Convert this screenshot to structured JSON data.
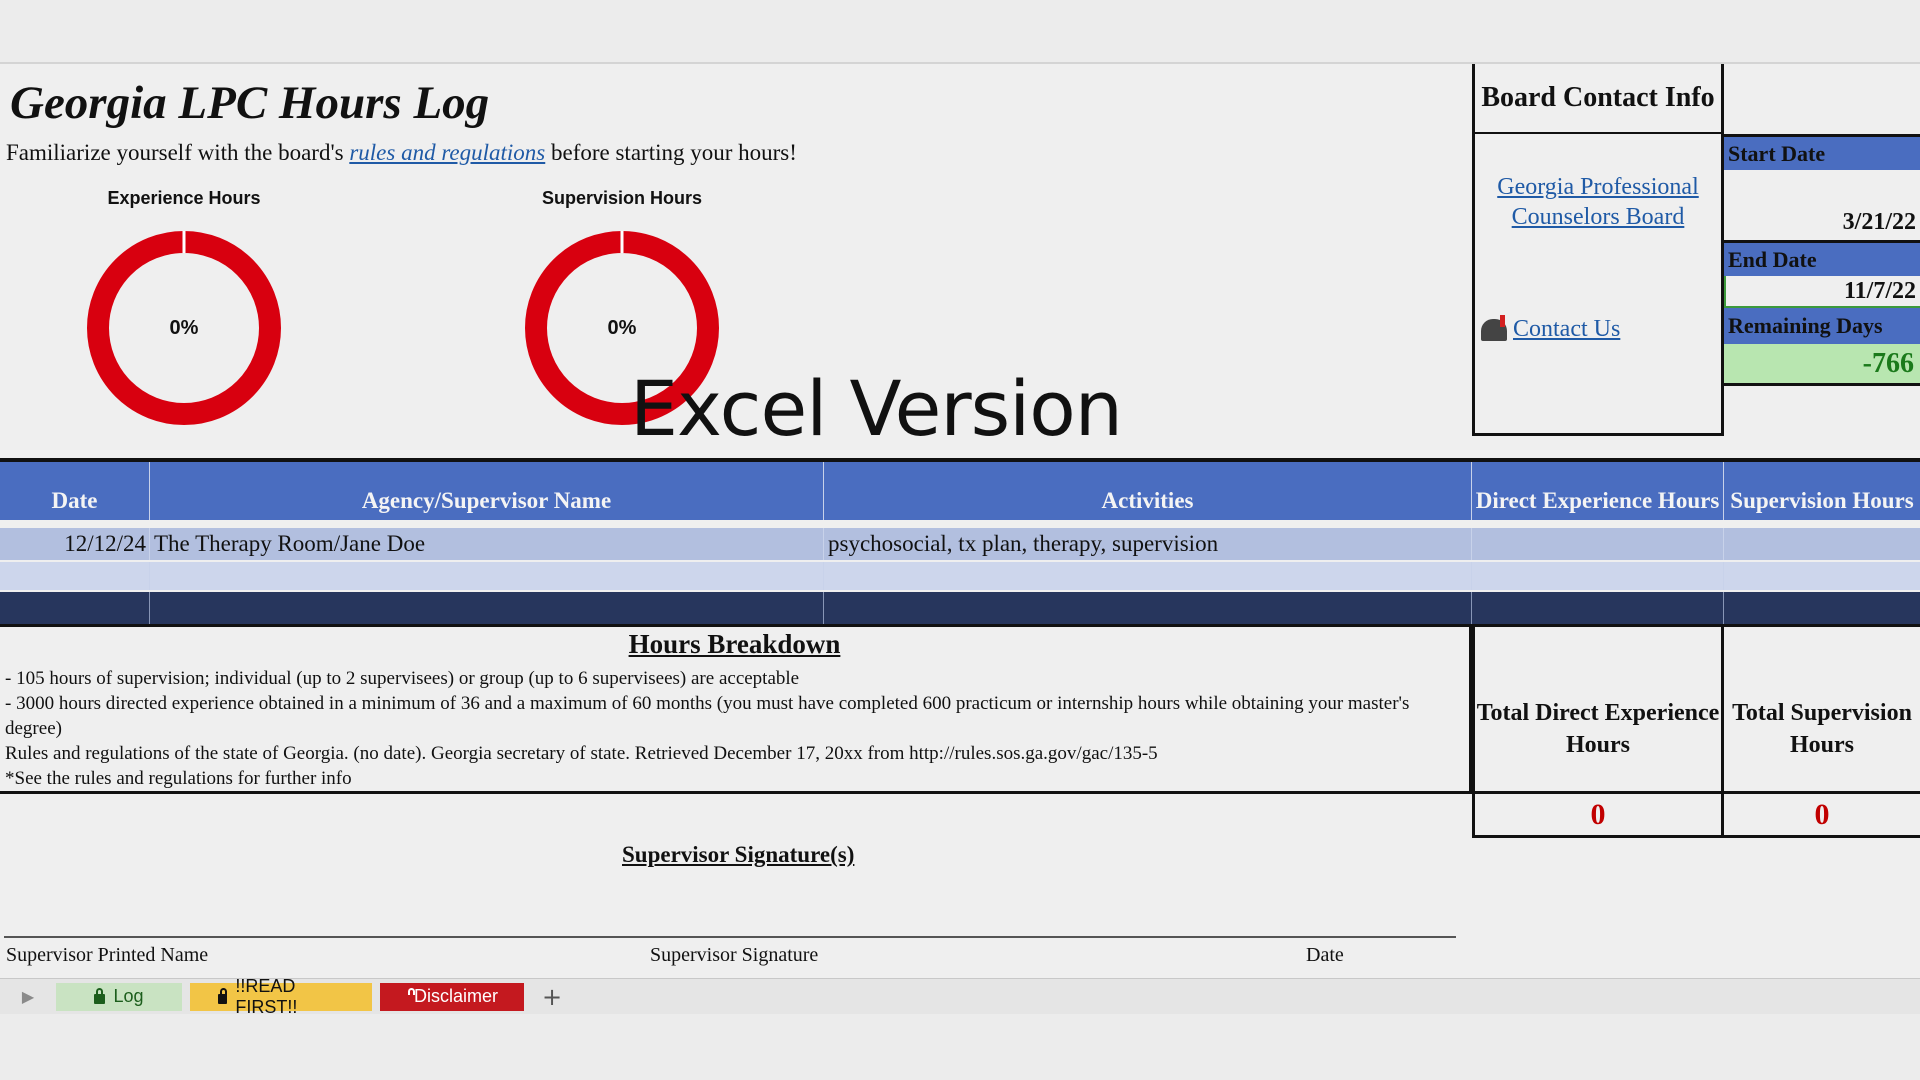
{
  "sheet": {
    "title": "Georgia LPC Hours Log",
    "subtitle_pre": "Familiarize yourself with the board's ",
    "subtitle_link": "rules and regulations",
    "subtitle_post": " before starting your hours!",
    "overlay_text": "Excel Version"
  },
  "charts": [
    {
      "label": "Experience Hours",
      "percent_text": "0%",
      "progress": 0,
      "color": "#d8000f"
    },
    {
      "label": "Supervision Hours",
      "percent_text": "0%",
      "progress": 0,
      "color": "#d8000f"
    }
  ],
  "contact": {
    "heading": "Board Contact Info",
    "board_link": "Georgia Professional Counselors Board",
    "contact_us": "Contact Us",
    "contact_icon": "mailbox-icon"
  },
  "dates": {
    "start_label": "Start Date",
    "start_value": "3/21/22",
    "end_label": "End Date",
    "end_value": "11/7/22",
    "remaining_label": "Remaining Days",
    "remaining_value": "-766"
  },
  "log_table": {
    "headers": [
      "Date",
      "Agency/Supervisor Name",
      "Activities",
      "Direct Experience Hours",
      "Supervision Hours"
    ],
    "rows": [
      {
        "date": "12/12/24",
        "agency": "The Therapy Room/Jane Doe",
        "activities": "psychosocial, tx plan, therapy, supervision",
        "direct": "",
        "supervision": ""
      }
    ]
  },
  "breakdown": {
    "title": "Hours Breakdown",
    "lines": [
      "- 105 hours of supervision; individual (up to 2 supervisees) or group (up to 6 supervisees) are acceptable",
      "- 3000 hours directed experience obtained in a minimum of 36 and a maximum of 60 months (you must have completed 600 practicum or internship hours while obtaining your master's degree)",
      "Rules and regulations of the state of Georgia. (no date). Georgia secretary of state. Retrieved December 17, 20xx from http://rules.sos.ga.gov/gac/135-5",
      "*See the rules and regulations for further info"
    ]
  },
  "totals": {
    "direct_label": "Total Direct Experience Hours",
    "direct_value": "0",
    "supervision_label": "Total Supervision Hours",
    "supervision_value": "0"
  },
  "signature": {
    "title": "Supervisor Signature(s)",
    "printed_name": "Supervisor Printed Name",
    "signature": "Supervisor Signature",
    "date": "Date"
  },
  "tabs": [
    {
      "label": "Log",
      "icon": "lock-icon"
    },
    {
      "label": "!!READ FIRST!!",
      "icon": "lock-icon"
    },
    {
      "label": "Disclaimer",
      "icon": "lock-icon"
    }
  ],
  "tab_add": "+",
  "tab_nav": "▶"
}
